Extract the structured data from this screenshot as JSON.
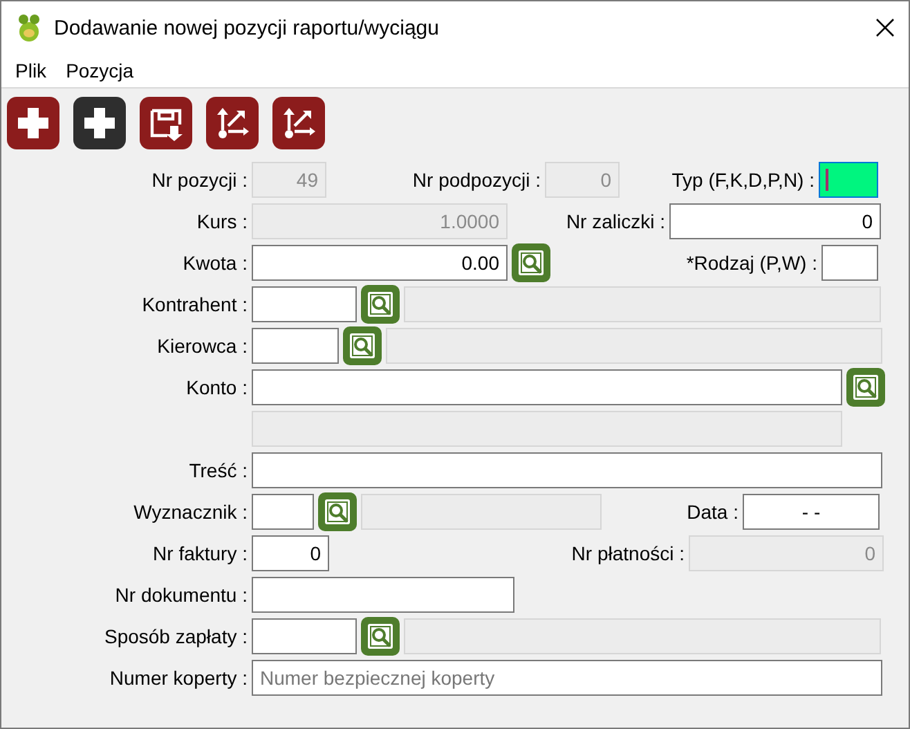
{
  "window": {
    "title": "Dodawanie nowej pozycji raportu/wyciągu"
  },
  "menu": [
    {
      "label": "Plik"
    },
    {
      "label": "Pozycja"
    }
  ],
  "toolbar": [
    {
      "kind": "add",
      "color": "#8c1c1c"
    },
    {
      "kind": "add",
      "color": "#2e2e2e"
    },
    {
      "kind": "save",
      "color": "#8c1c1c"
    },
    {
      "kind": "move",
      "color": "#8c1c1c"
    },
    {
      "kind": "move",
      "color": "#8c1c1c"
    }
  ],
  "form": {
    "rows": [
      {
        "items": [
          {
            "kind": "label",
            "text": "Nr pozycji :"
          },
          {
            "kind": "field",
            "value": "49",
            "disabled": true
          },
          {
            "kind": "label",
            "text": "Nr podpozycji :"
          },
          {
            "kind": "field",
            "value": "0",
            "disabled": true
          },
          {
            "kind": "label",
            "text": "Typ (F,K,D,P,N) :"
          },
          {
            "kind": "field",
            "disabled": false,
            "focused": true
          }
        ]
      },
      {
        "items": [
          {
            "kind": "label",
            "text": "Kurs :"
          },
          {
            "kind": "field",
            "value": "1.0000",
            "disabled": true
          },
          {
            "kind": "label",
            "text": "Nr zaliczki :"
          },
          {
            "kind": "field",
            "value": "0",
            "disabled": false
          }
        ]
      },
      {
        "items": [
          {
            "kind": "label",
            "text": "Kwota :"
          },
          {
            "kind": "field",
            "value": "0.00",
            "disabled": false
          },
          {
            "kind": "lookup"
          },
          {
            "kind": "label",
            "text": "*Rodzaj (P,W) :"
          },
          {
            "kind": "field",
            "disabled": false
          }
        ]
      },
      {
        "items": [
          {
            "kind": "label",
            "text": "Kontrahent :"
          },
          {
            "kind": "field",
            "disabled": false
          },
          {
            "kind": "lookup"
          },
          {
            "kind": "field",
            "disabled": true
          }
        ]
      },
      {
        "items": [
          {
            "kind": "label",
            "text": "Kierowca :"
          },
          {
            "kind": "field",
            "disabled": false
          },
          {
            "kind": "lookup"
          },
          {
            "kind": "field",
            "disabled": true
          }
        ]
      },
      {
        "items": [
          {
            "kind": "label",
            "text": "Konto :"
          },
          {
            "kind": "field",
            "disabled": false
          },
          {
            "kind": "lookup"
          }
        ]
      },
      {
        "items": [
          {
            "kind": "field",
            "disabled": true
          }
        ]
      },
      {
        "items": [
          {
            "kind": "label",
            "text": "Treść :"
          },
          {
            "kind": "field",
            "disabled": false
          }
        ]
      },
      {
        "items": [
          {
            "kind": "label",
            "text": "Wyznacznik :"
          },
          {
            "kind": "field",
            "disabled": false
          },
          {
            "kind": "lookup"
          },
          {
            "kind": "field",
            "disabled": true
          },
          {
            "kind": "label",
            "text": "Data :"
          },
          {
            "kind": "field",
            "value": "- -",
            "disabled": false
          }
        ]
      },
      {
        "items": [
          {
            "kind": "label",
            "text": "Nr faktury :"
          },
          {
            "kind": "field",
            "value": "0",
            "disabled": false
          },
          {
            "kind": "label",
            "text": "Nr płatności :"
          },
          {
            "kind": "field",
            "value": "0",
            "disabled": true
          }
        ]
      },
      {
        "items": [
          {
            "kind": "label",
            "text": "Nr dokumentu :"
          },
          {
            "kind": "field",
            "disabled": false
          }
        ]
      },
      {
        "items": [
          {
            "kind": "label",
            "text": "Sposób zapłaty :"
          },
          {
            "kind": "field",
            "disabled": false
          },
          {
            "kind": "lookup"
          },
          {
            "kind": "field",
            "disabled": true
          }
        ]
      },
      {
        "items": [
          {
            "kind": "label",
            "text": "Numer koperty :"
          },
          {
            "kind": "field",
            "placeholder": "Numer bezpiecznej koperty",
            "disabled": false
          }
        ]
      }
    ]
  }
}
